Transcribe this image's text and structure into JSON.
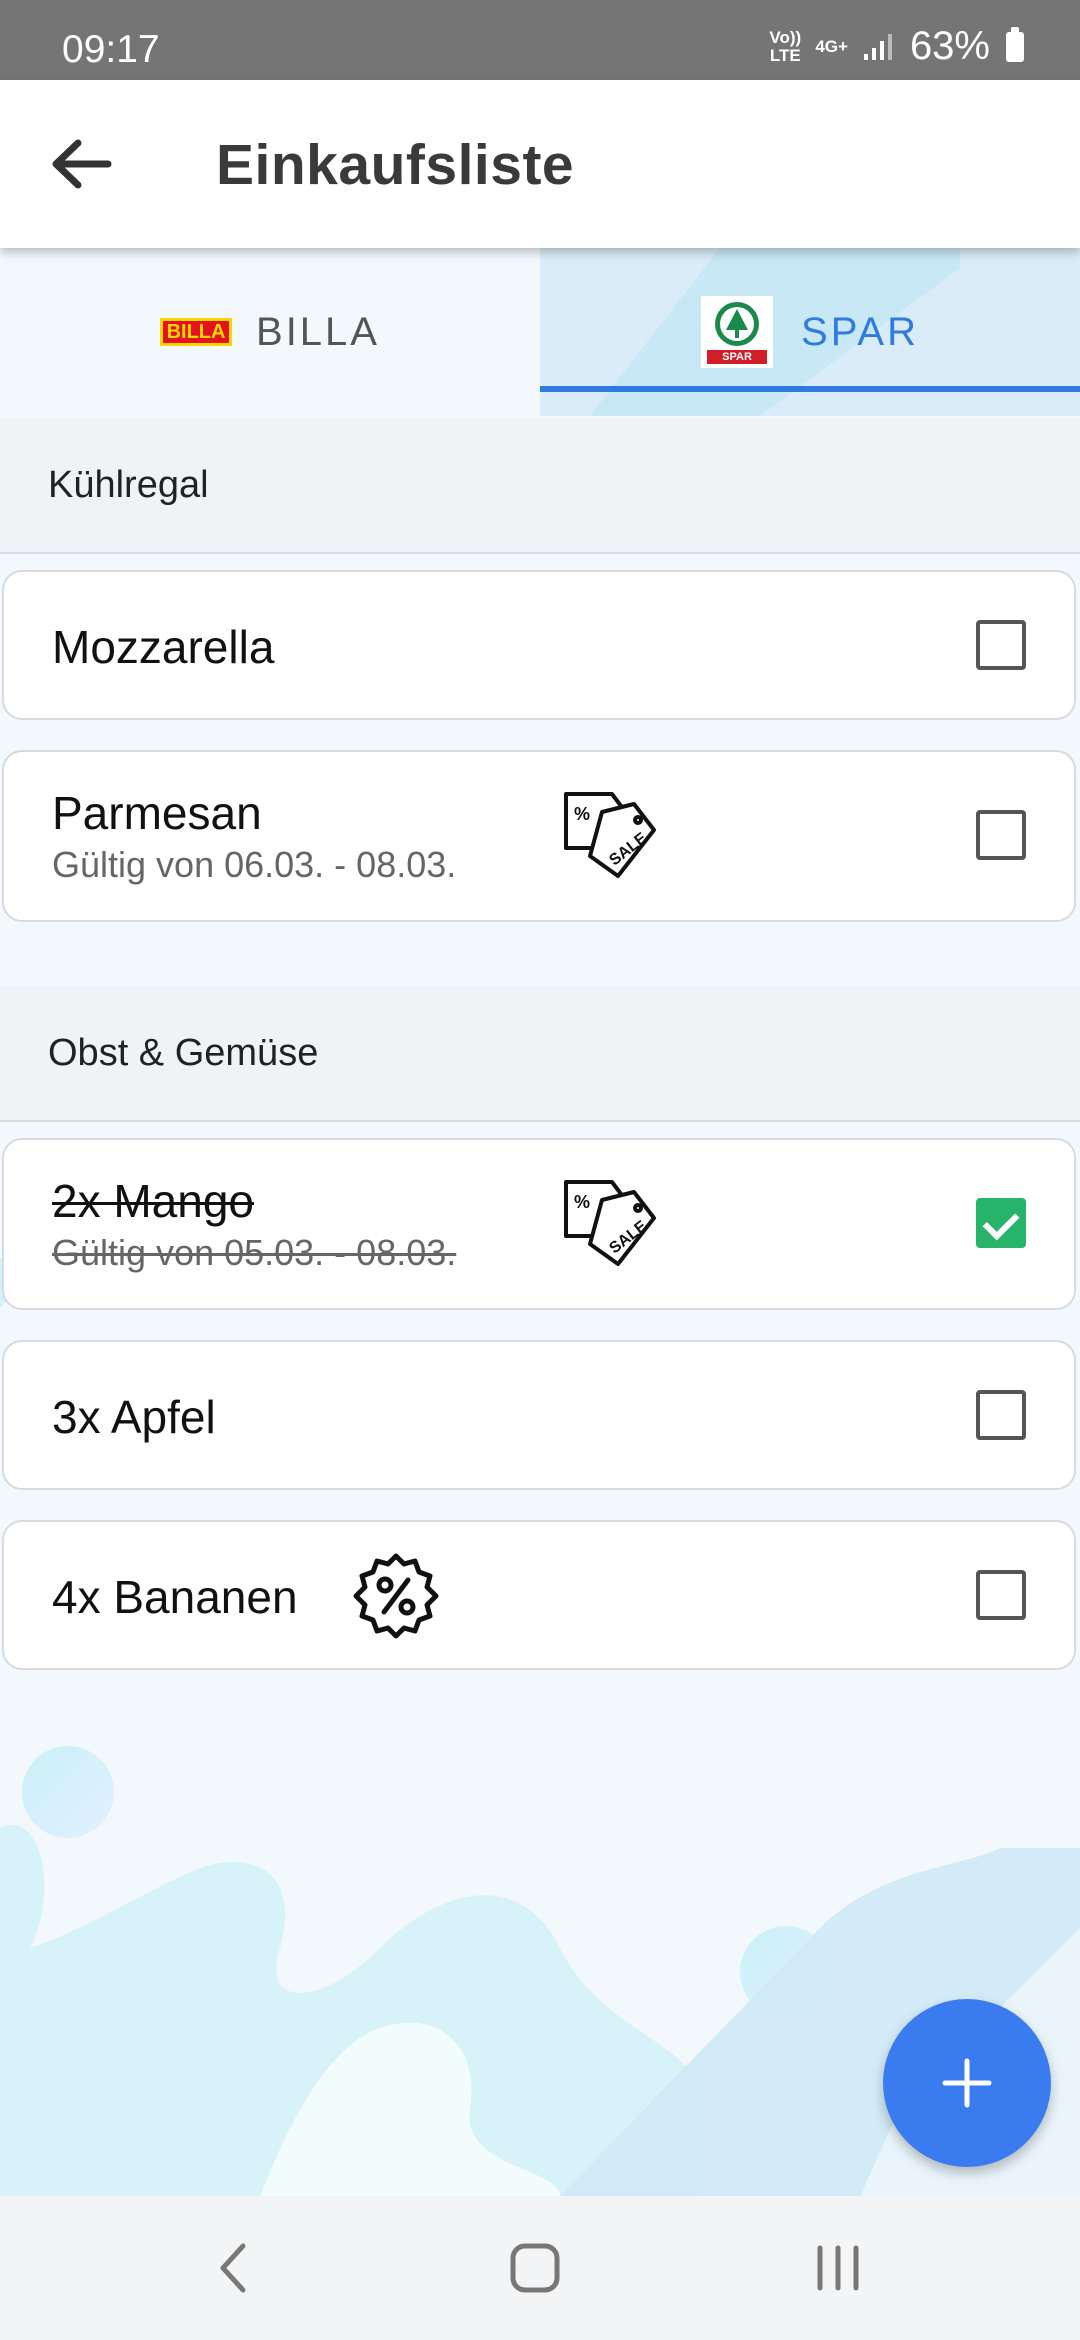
{
  "status_bar": {
    "time": "09:17",
    "net_volte": "Vo)) LTE",
    "net_4g": "4G+",
    "battery": "63%"
  },
  "app_bar": {
    "title": "Einkaufsliste"
  },
  "tabs": [
    {
      "label": "BILLA",
      "logo_text": "BILLA",
      "selected": false
    },
    {
      "label": "SPAR",
      "logo_text": "SPAR",
      "selected": true
    }
  ],
  "sections": [
    {
      "title": "Kühlregal",
      "items": [
        {
          "name": "Mozzarella",
          "checked": false
        },
        {
          "name": "Parmesan",
          "validity": "Gültig von 06.03. - 08.03.",
          "checked": false,
          "icon": "sale-tags-icon"
        }
      ]
    },
    {
      "title": "Obst & Gemüse",
      "items": [
        {
          "name": "2x Mango",
          "validity": "Gültig von 05.03. - 08.03.",
          "checked": true,
          "icon": "sale-tags-icon"
        },
        {
          "name": "3x Apfel",
          "checked": false
        },
        {
          "name": "4x Bananen",
          "checked": false,
          "icon": "discount-badge-icon"
        }
      ]
    }
  ],
  "colors": {
    "accent": "#2f7be0",
    "fab": "#3a7cf0",
    "checked": "#27b36a",
    "status_bar": "#757575"
  }
}
